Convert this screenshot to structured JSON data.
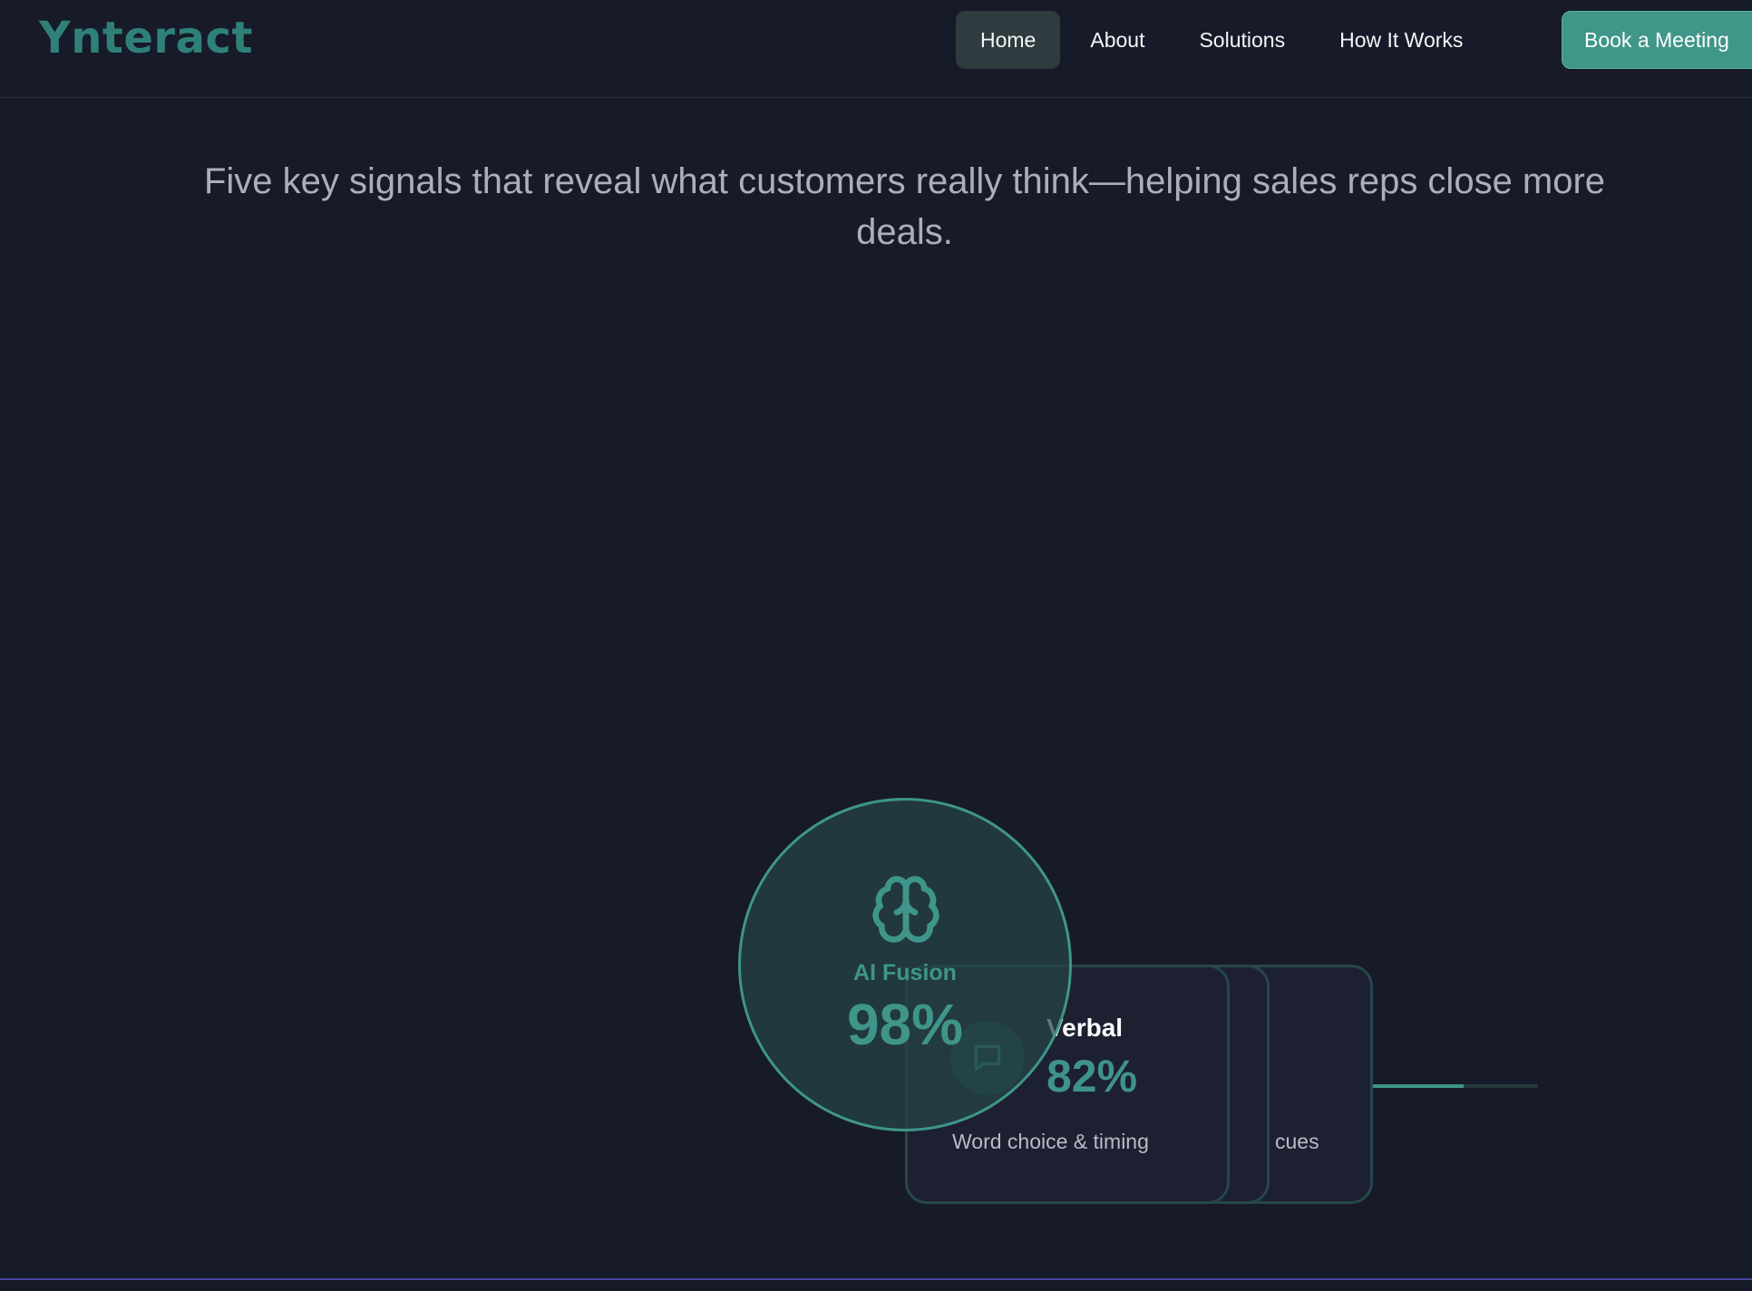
{
  "header": {
    "logo": "Ynteract",
    "nav": [
      {
        "label": "Home",
        "active": true
      },
      {
        "label": "About",
        "active": false
      },
      {
        "label": "Solutions",
        "active": false
      },
      {
        "label": "How It Works",
        "active": false
      }
    ],
    "cta_label": "Book a Meeting"
  },
  "hero": {
    "subtitle": "Five key signals that reveal what customers really think—helping sales reps close more deals."
  },
  "fusion": {
    "icon": "brain-icon",
    "label": "AI Fusion",
    "value": "98%"
  },
  "signals": {
    "front": {
      "icon": "message-icon",
      "title": "Verbal",
      "value": "82%",
      "description": "Word choice & timing"
    },
    "back": {
      "description_fragment": "cues",
      "progress": 0.55
    }
  },
  "colors": {
    "background": "#171a28",
    "accent": "#3f958a",
    "logo": "#2f8178",
    "card_border": "#26474a",
    "bottom_line": "#4a48a6"
  }
}
